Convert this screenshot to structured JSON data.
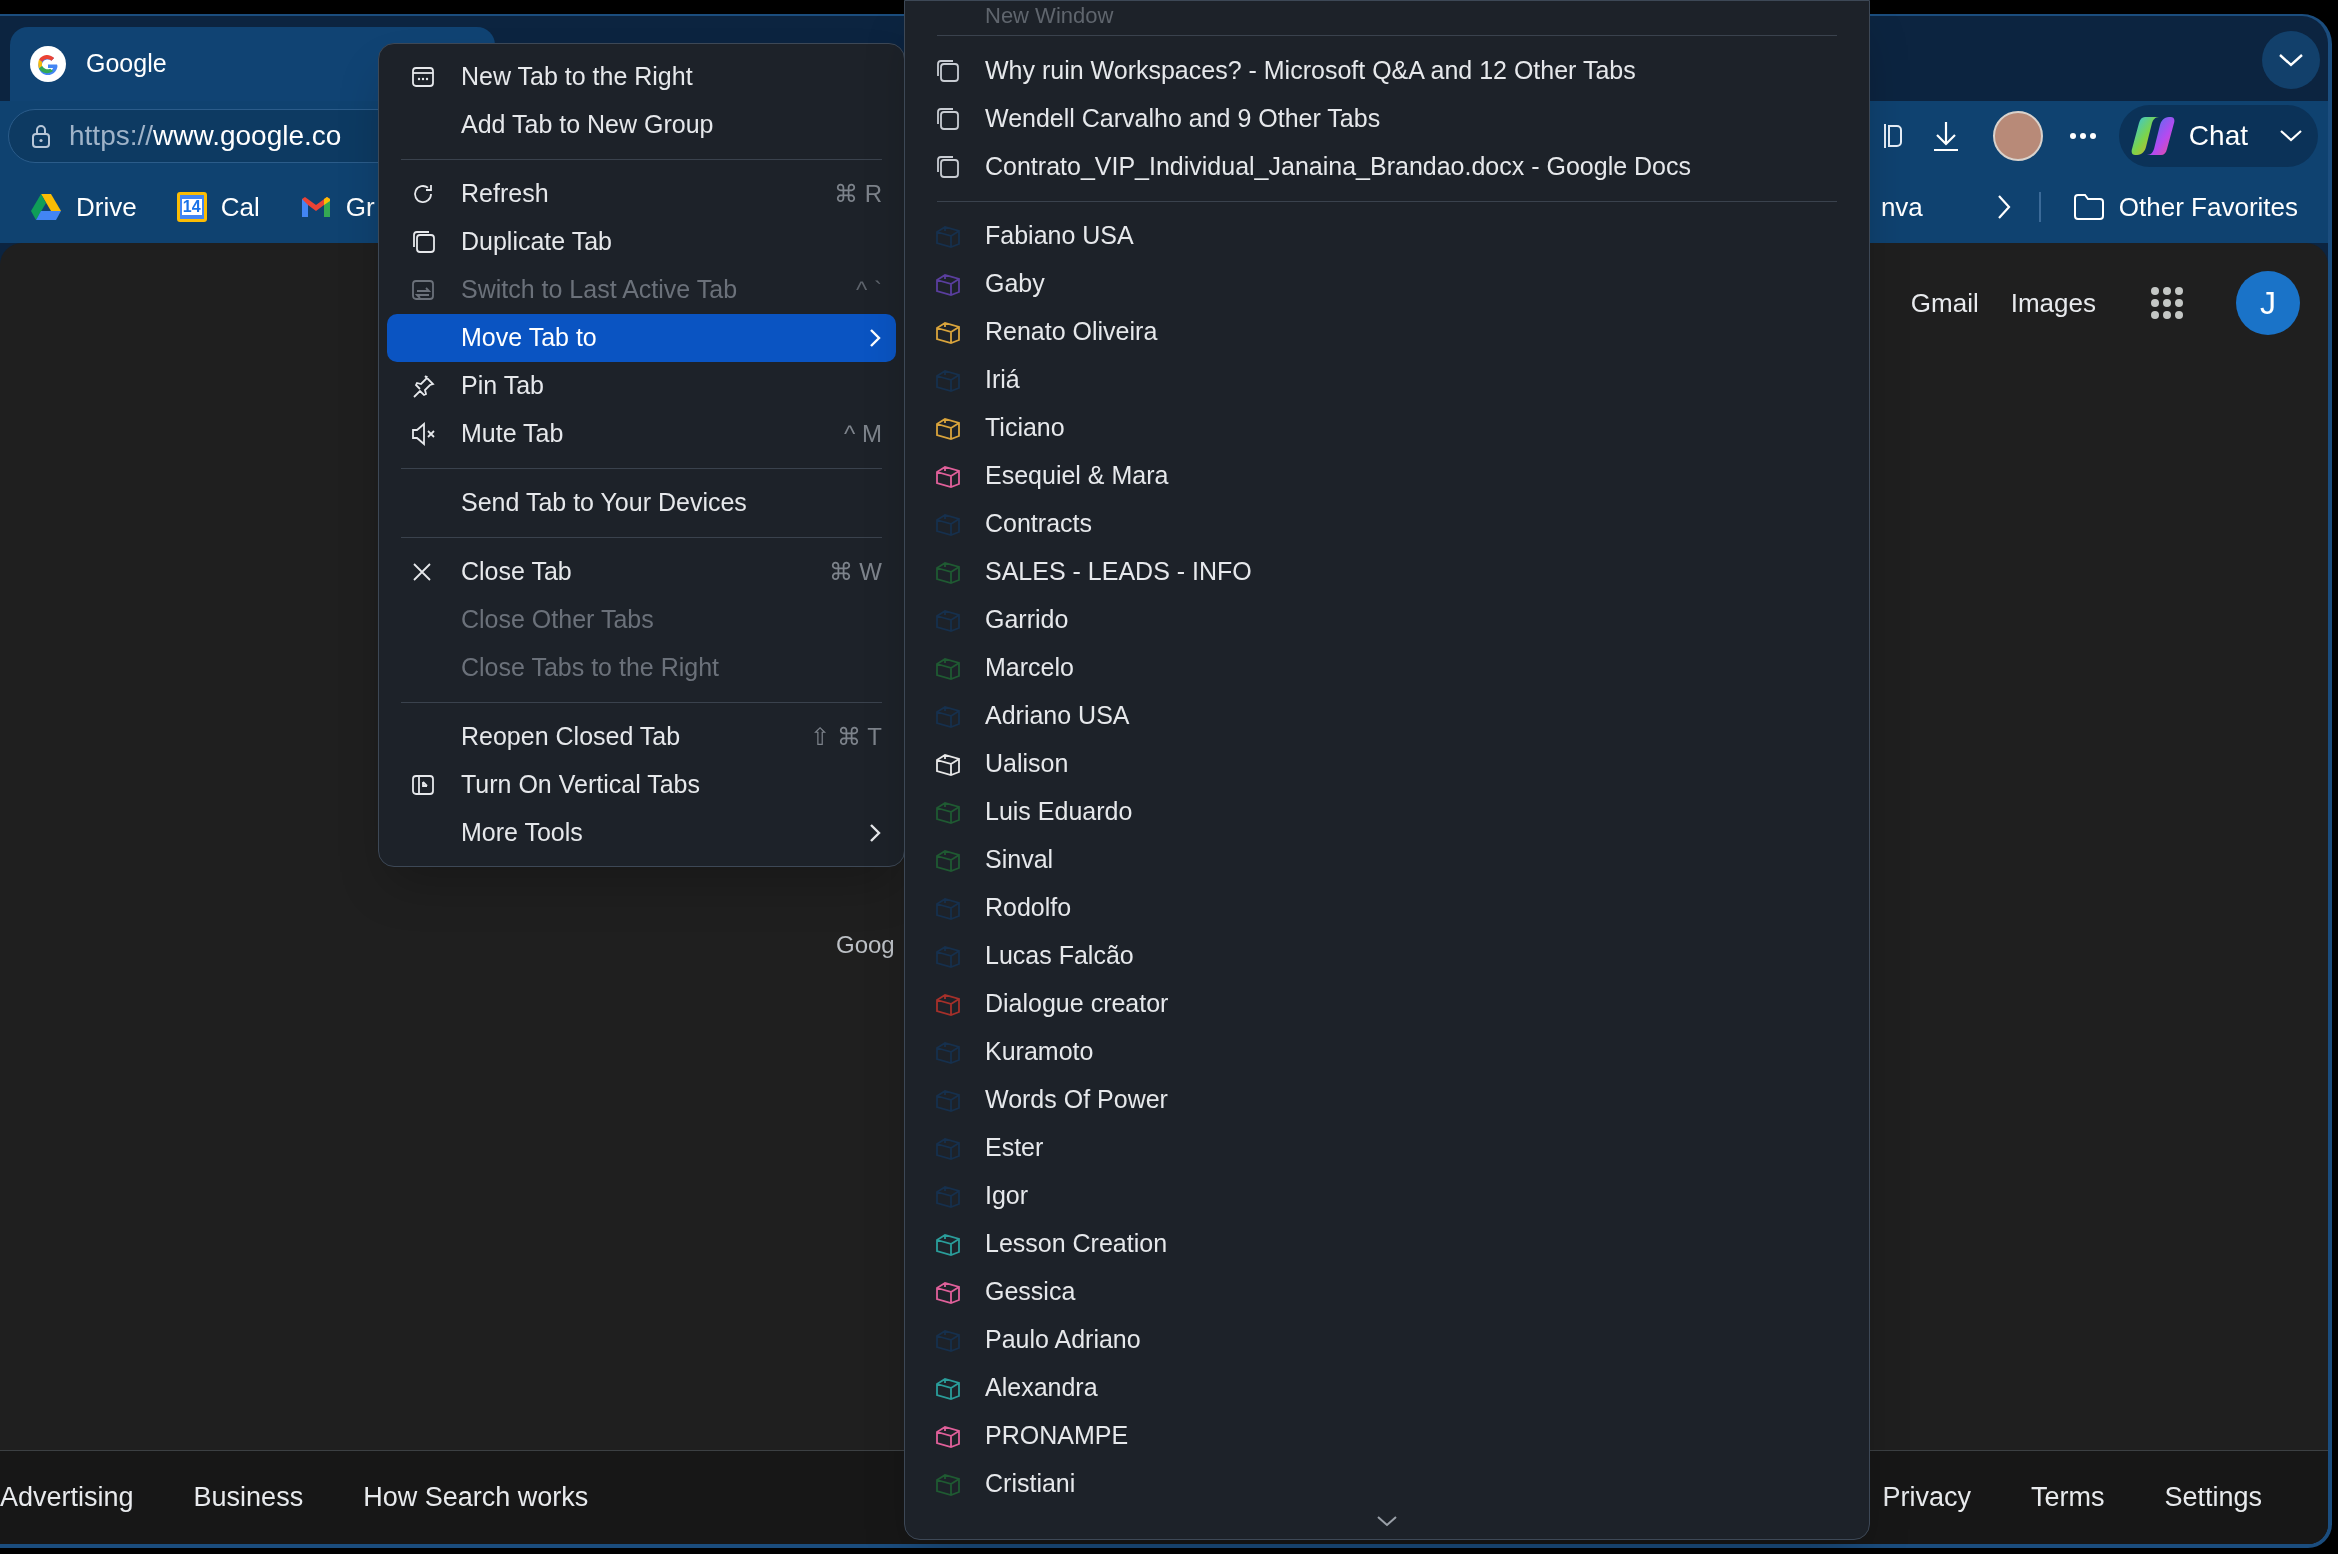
{
  "tab": {
    "title": "Google",
    "selected": true
  },
  "address_bar": {
    "protocol": "https://",
    "host": "www.google.co"
  },
  "toolbar": {
    "chat_label": "Chat"
  },
  "bookmarks": {
    "items": [
      {
        "label": "Drive",
        "kind": "drive"
      },
      {
        "label": "Cal",
        "kind": "calendar",
        "icon_text": "14"
      },
      {
        "label": "Gr",
        "kind": "mail"
      },
      {
        "label": "nva",
        "kind": "plain"
      }
    ],
    "other": "Other Favorites"
  },
  "page": {
    "header_links": [
      "Gmail",
      "Images"
    ],
    "account_initial": "J",
    "partial_text": "Goog",
    "footer_left": [
      "Advertising",
      "Business",
      "How Search works"
    ],
    "footer_right": [
      "Privacy",
      "Terms",
      "Settings"
    ]
  },
  "context_menu": {
    "sections": [
      [
        {
          "label": "New Tab to the Right",
          "disabled": false,
          "selected": false,
          "submenu": false
        },
        {
          "label": "Add Tab to New Group",
          "disabled": false,
          "selected": false,
          "submenu": false
        }
      ],
      [
        {
          "label": "Refresh",
          "shortcut": "⌘ R",
          "disabled": false,
          "selected": false,
          "submenu": false
        },
        {
          "label": "Duplicate Tab",
          "disabled": false,
          "selected": false,
          "submenu": false
        },
        {
          "label": "Switch to Last Active Tab",
          "shortcut": "^ `",
          "disabled": true,
          "selected": false,
          "submenu": false
        },
        {
          "label": "Move Tab to",
          "disabled": false,
          "selected": true,
          "submenu": true
        },
        {
          "label": "Pin Tab",
          "disabled": false,
          "selected": false,
          "submenu": false
        },
        {
          "label": "Mute Tab",
          "shortcut": "^ M",
          "disabled": false,
          "selected": false,
          "submenu": false
        }
      ],
      [
        {
          "label": "Send Tab to Your Devices",
          "disabled": false,
          "selected": false,
          "submenu": false
        }
      ],
      [
        {
          "label": "Close Tab",
          "shortcut": "⌘ W",
          "disabled": false,
          "selected": false,
          "submenu": false
        },
        {
          "label": "Close Other Tabs",
          "disabled": true,
          "selected": false,
          "submenu": false
        },
        {
          "label": "Close Tabs to the Right",
          "disabled": true,
          "selected": false,
          "submenu": false
        }
      ],
      [
        {
          "label": "Reopen Closed Tab",
          "shortcut": "⇧ ⌘ T",
          "disabled": false,
          "selected": false,
          "submenu": false
        },
        {
          "label": "Turn On Vertical Tabs",
          "disabled": false,
          "selected": false,
          "submenu": false
        },
        {
          "label": "More Tools",
          "disabled": false,
          "selected": false,
          "submenu": true
        }
      ]
    ]
  },
  "submenu": {
    "new_window": {
      "label": "New Window",
      "disabled": true
    },
    "windows": [
      "Why ruin Workspaces? - Microsoft Q&A and 12 Other Tabs",
      "Wendell Carvalho and 9 Other Tabs",
      "Contrato_VIP_Individual_Janaina_Brandao.docx - Google Docs"
    ],
    "groups": [
      {
        "label": "Fabiano USA",
        "color": "#16304d"
      },
      {
        "label": "Gaby",
        "color": "#5a3e9e"
      },
      {
        "label": "Renato Oliveira",
        "color": "#d9a43c"
      },
      {
        "label": "Iriá",
        "color": "#16304d"
      },
      {
        "label": "Ticiano",
        "color": "#d9a43c"
      },
      {
        "label": "Esequiel & Mara",
        "color": "#e0609a"
      },
      {
        "label": "Contracts",
        "color": "#16304d"
      },
      {
        "label": "SALES - LEADS - INFO",
        "color": "#1f5a32"
      },
      {
        "label": "Garrido",
        "color": "#16304d"
      },
      {
        "label": "Marcelo",
        "color": "#1f5a32"
      },
      {
        "label": "Adriano USA",
        "color": "#16304d"
      },
      {
        "label": "Ualison",
        "color": "#e8e8e8"
      },
      {
        "label": "Luis Eduardo",
        "color": "#1f5a32"
      },
      {
        "label": "Sinval",
        "color": "#1f5a32"
      },
      {
        "label": "Rodolfo",
        "color": "#16304d"
      },
      {
        "label": "Lucas Falcão",
        "color": "#16304d"
      },
      {
        "label": "Dialogue creator",
        "color": "#a5302a"
      },
      {
        "label": "Kuramoto",
        "color": "#16304d"
      },
      {
        "label": "Words Of Power",
        "color": "#16304d"
      },
      {
        "label": "Ester",
        "color": "#16304d"
      },
      {
        "label": "Igor",
        "color": "#16304d"
      },
      {
        "label": "Lesson Creation",
        "color": "#2a9d9a"
      },
      {
        "label": "Gessica",
        "color": "#e0609a"
      },
      {
        "label": "Paulo Adriano",
        "color": "#16304d"
      },
      {
        "label": "Alexandra",
        "color": "#2a9d9a"
      },
      {
        "label": "PRONAMPE",
        "color": "#e0609a"
      },
      {
        "label": "Cristiani",
        "color": "#1f5a32"
      }
    ]
  }
}
